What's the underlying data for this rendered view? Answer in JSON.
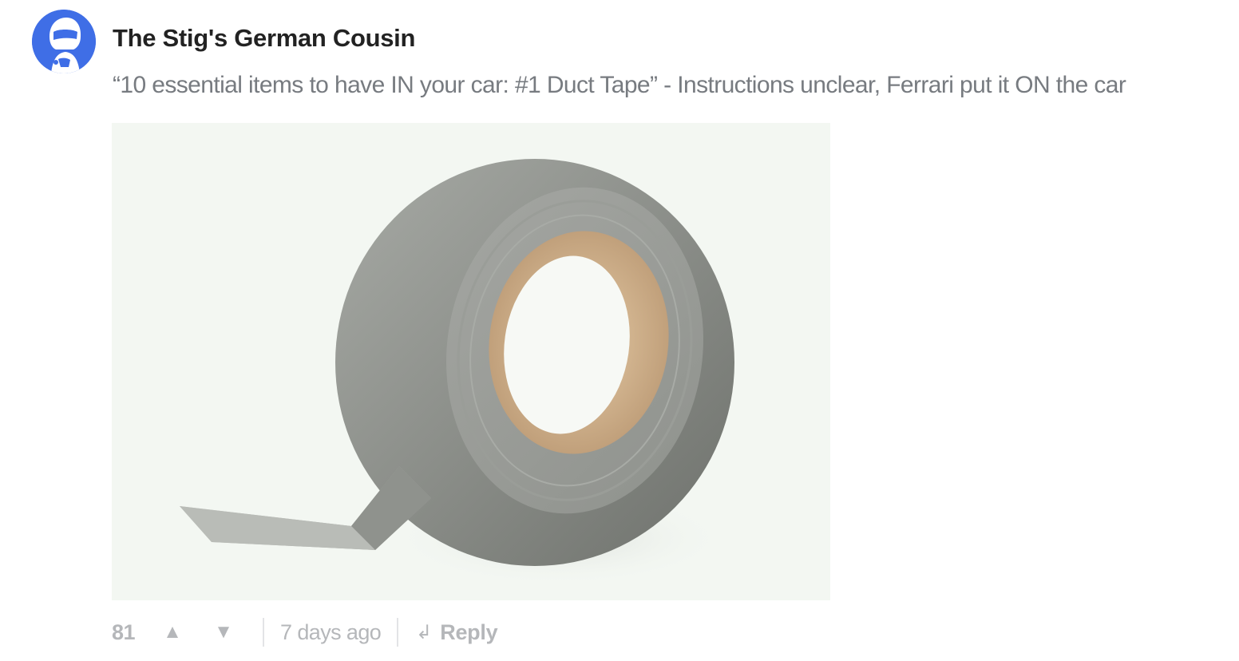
{
  "comment": {
    "author": "The Stig's German Cousin",
    "avatar_icon": "stig-helmet-avatar-icon",
    "avatar_color": "#3f6ee6",
    "text": "“10 essential items to have IN your car: #1 Duct Tape” - Instructions unclear, Ferrari put it ON the car",
    "image": {
      "subject": "duct-tape-roll",
      "background_color": "#f3f7f2"
    },
    "actions": {
      "score": "81",
      "upvote_icon": "▲",
      "downvote_icon": "▼",
      "timestamp": "7 days ago",
      "reply_icon": "↲",
      "reply_label": "Reply",
      "muted_color": "#b5b7ba"
    }
  }
}
